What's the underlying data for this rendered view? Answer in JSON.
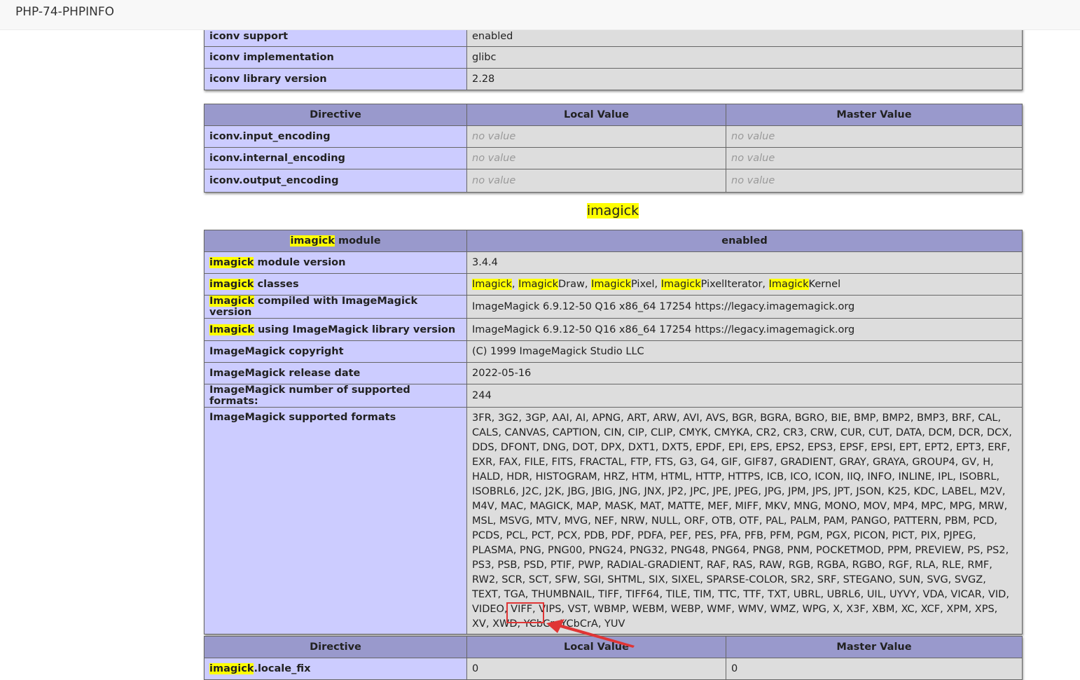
{
  "window": {
    "title": "PHP-74-PHPINFO"
  },
  "iconv_info": [
    {
      "key": "iconv support",
      "value": "enabled"
    },
    {
      "key": "iconv implementation",
      "value": "glibc"
    },
    {
      "key": "iconv library version",
      "value": "2.28"
    }
  ],
  "iconv_directives": {
    "headers": [
      "Directive",
      "Local Value",
      "Master Value"
    ],
    "rows": [
      {
        "directive": "iconv.input_encoding",
        "local": "no value",
        "master": "no value"
      },
      {
        "directive": "iconv.internal_encoding",
        "local": "no value",
        "master": "no value"
      },
      {
        "directive": "iconv.output_encoding",
        "local": "no value",
        "master": "no value"
      }
    ]
  },
  "imagick": {
    "heading": "imagick",
    "header": {
      "key_hl": "imagick",
      "key_rest": " module",
      "value": "enabled"
    },
    "module_version": {
      "key_hl": "imagick",
      "key_rest": " module version",
      "value": "3.4.4"
    },
    "classes": {
      "key_hl": "imagick",
      "key_rest": " classes",
      "items": [
        {
          "hl": "Imagick",
          "rest": ", "
        },
        {
          "hl": "Imagick",
          "rest": "Draw, "
        },
        {
          "hl": "Imagick",
          "rest": "Pixel, "
        },
        {
          "hl": "Imagick",
          "rest": "PixelIterator, "
        },
        {
          "hl": "Imagick",
          "rest": "Kernel"
        }
      ]
    },
    "compiled": {
      "key_hl": "Imagick",
      "key_rest": " compiled with ImageMagick version",
      "value": "ImageMagick 6.9.12-50 Q16 x86_64 17254 https://legacy.imagemagick.org"
    },
    "using": {
      "key_hl": "Imagick",
      "key_rest": " using ImageMagick library version",
      "value": "ImageMagick 6.9.12-50 Q16 x86_64 17254 https://legacy.imagemagick.org"
    },
    "copyright": {
      "key": "ImageMagick copyright",
      "value": "(C) 1999 ImageMagick Studio LLC"
    },
    "release_date": {
      "key": "ImageMagick release date",
      "value": "2022-05-16"
    },
    "num_formats": {
      "key": "ImageMagick number of supported formats:",
      "value": "244"
    },
    "formats": {
      "key": "ImageMagick supported formats",
      "before_webp": "3FR, 3G2, 3GP, AAI, AI, APNG, ART, ARW, AVI, AVS, BGR, BGRA, BGRO, BIE, BMP, BMP2, BMP3, BRF, CAL, CALS, CANVAS, CAPTION, CIN, CIP, CLIP, CMYK, CMYKA, CR2, CR3, CRW, CUR, CUT, DATA, DCM, DCR, DCX, DDS, DFONT, DNG, DOT, DPX, DXT1, DXT5, EPDF, EPI, EPS, EPS2, EPS3, EPSF, EPSI, EPT, EPT2, EPT3, ERF, EXR, FAX, FILE, FITS, FRACTAL, FTP, FTS, G3, G4, GIF, GIF87, GRADIENT, GRAY, GRAYA, GROUP4, GV, H, HALD, HDR, HISTOGRAM, HRZ, HTM, HTML, HTTP, HTTPS, ICB, ICO, ICON, IIQ, INFO, INLINE, IPL, ISOBRL, ISOBRL6, J2C, J2K, JBG, JBIG, JNG, JNX, JP2, JPC, JPE, JPEG, JPG, JPM, JPS, JPT, JSON, K25, KDC, LABEL, M2V, M4V, MAC, MAGICK, MAP, MASK, MAT, MATTE, MEF, MIFF, MKV, MNG, MONO, MOV, MP4, MPC, MPG, MRW, MSL, MSVG, MTV, MVG, NEF, NRW, NULL, ORF, OTB, OTF, PAL, PALM, PAM, PANGO, PATTERN, PBM, PCD, PCDS, PCL, PCT, PCX, PDB, PDF, PDFA, PEF, PES, PFA, PFB, PFM, PGM, PGX, PICON, PICT, PIX, PJPEG, PLASMA, PNG, PNG00, PNG24, PNG32, PNG48, PNG64, PNG8, PNM, POCKETMOD, PPM, PREVIEW, PS, PS2, PS3, PSB, PSD, PTIF, PWP, RADIAL-GRADIENT, RAF, RAS, RAW, RGB, RGBA, RGBO, RGF, RLA, RLE, RMF, RW2, SCR, SCT, SFW, SGI, SHTML, SIX, SIXEL, SPARSE-COLOR, SR2, SRF, STEGANO, SUN, SVG, SVGZ, TEXT, TGA, THUMBNAIL, TIFF, TIFF64, TILE, TIM, TTC, TTF, TXT, UBRL, UBRL6, UIL, UYVY, VDA, VICAR, VID, VIDEO, VIFF, VIPS, VST, WBMP, WEBM, ",
      "webp": "WEBP,",
      "after_webp": " WMF, WMV, WMZ, WPG, X, X3F, XBM, XC, XCF, XPM, XPS, XV, XWD, YCbCr, YCbCrA, YUV"
    }
  },
  "imagick_directives": {
    "headers": [
      "Directive",
      "Local Value",
      "Master Value"
    ],
    "rows": [
      {
        "directive_hl": "imagick",
        "directive_rest": ".locale_fix",
        "local": "0",
        "master": "0"
      }
    ]
  },
  "colors": {
    "header_bg": "#9999cc",
    "key_bg": "#ccccff",
    "value_bg": "#dddddd",
    "highlight": "#ffff00",
    "annotation": "#e03535"
  }
}
